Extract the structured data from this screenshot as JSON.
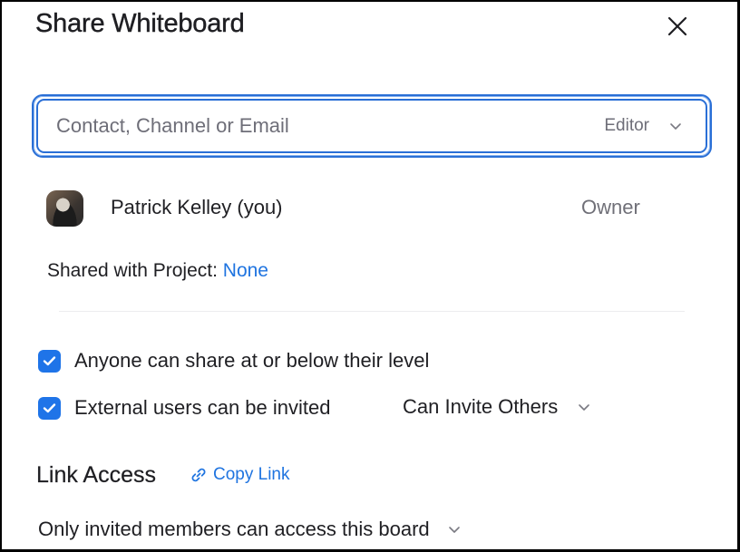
{
  "dialog": {
    "title": "Share Whiteboard",
    "close_icon": "close-icon"
  },
  "invite": {
    "placeholder": "Contact, Channel or Email",
    "value": "",
    "role_selected": "Editor",
    "chevron_icon": "chevron-down-icon",
    "focus_color": "#2a6fd6"
  },
  "members": [
    {
      "name": "Patrick Kelley (you)",
      "role": "Owner",
      "avatar_icon": "avatar"
    }
  ],
  "project": {
    "label": "Shared with Project:",
    "value": "None",
    "link_color": "#1f74e0"
  },
  "options": [
    {
      "label": "Anyone can share at or below their level",
      "checked": true
    },
    {
      "label": "External users can be invited",
      "checked": true
    }
  ],
  "external_permission": {
    "selected": "Can Invite Others"
  },
  "link_access": {
    "heading": "Link Access",
    "copy_label": "Copy Link",
    "copy_icon": "link-icon",
    "selected": "Only invited members can access this board"
  },
  "colors": {
    "accent": "#1f74e8",
    "text": "#1f1f23",
    "muted": "#6e6e78"
  }
}
